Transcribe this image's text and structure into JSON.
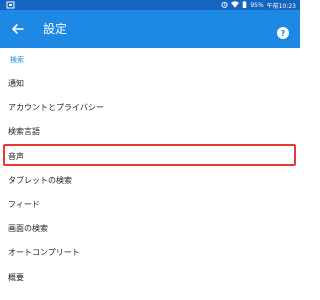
{
  "status_bar": {
    "battery": "95%",
    "time": "午前10:23"
  },
  "app_bar": {
    "title": "設定"
  },
  "section": {
    "header": "検索"
  },
  "menu": {
    "items": [
      {
        "label": "通知"
      },
      {
        "label": "アカウントとプライバシー"
      },
      {
        "label": "検索言語"
      },
      {
        "label": "音声"
      },
      {
        "label": "タブレットの検索"
      },
      {
        "label": "フィード"
      },
      {
        "label": "画面の検索"
      },
      {
        "label": "オートコンプリート"
      },
      {
        "label": "概要"
      }
    ]
  },
  "colors": {
    "status_bar": "#1565c0",
    "app_bar": "#1e88e5",
    "accent": "#1e88e5",
    "highlight": "#e53935"
  },
  "icons": {
    "back": "arrow-back-icon",
    "help": "help-circle-icon",
    "notification": "notification-icon",
    "alarm": "alarm-icon",
    "wifi": "wifi-icon",
    "battery": "battery-icon"
  }
}
